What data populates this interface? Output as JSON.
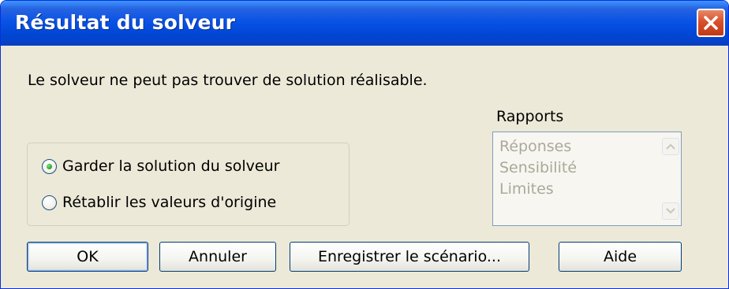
{
  "dialog": {
    "title": "Résultat du solveur",
    "close_icon": "close-icon",
    "message": "Le solveur ne peut pas trouver de solution réalisable."
  },
  "options": [
    {
      "label": "Garder la solution du solveur",
      "selected": true
    },
    {
      "label": "Rétablir les valeurs d'origine",
      "selected": false
    }
  ],
  "reports": {
    "label": "Rapports",
    "items": [
      "Réponses",
      "Sensibilité",
      "Limites"
    ],
    "scroll_icons": [
      "chevron-up-icon",
      "chevron-down-icon"
    ]
  },
  "buttons": {
    "ok": "OK",
    "cancel": "Annuler",
    "save_scenario": "Enregistrer le scénario...",
    "help": "Aide"
  },
  "colors": {
    "titlebar": "#0A53E6",
    "close_button": "#D9502A",
    "dialog_background": "#ECE9D8",
    "radio_selected": "#21A121",
    "disabled_text": "#ACA899"
  }
}
